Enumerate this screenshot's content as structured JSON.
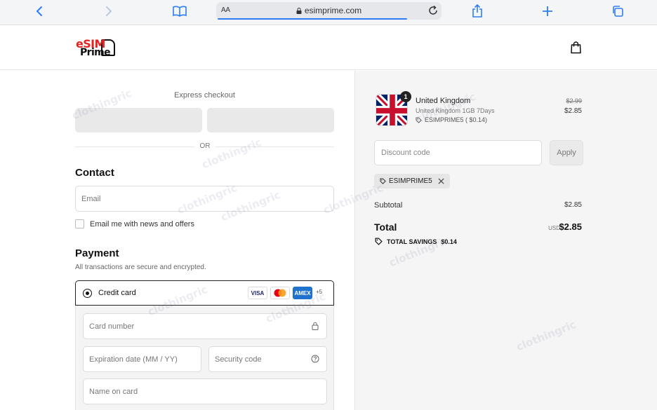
{
  "browser": {
    "aa": "AA",
    "url": "esimprime.com"
  },
  "header": {
    "logo_line1": "eSIM",
    "logo_line2": "Prime"
  },
  "express": {
    "label": "Express checkout",
    "or": "OR"
  },
  "contact": {
    "title": "Contact",
    "email_placeholder": "Email",
    "newsletter_label": "Email me with news and offers"
  },
  "payment": {
    "title": "Payment",
    "subtitle": "All transactions are secure and encrypted.",
    "method_label": "Credit card",
    "card_logos": [
      "VISA",
      "",
      "AMEX"
    ],
    "more_cards": "+5",
    "card_number_placeholder": "Card number",
    "expiration_placeholder": "Expiration date (MM / YY)",
    "security_placeholder": "Security code",
    "name_placeholder": "Name on card"
  },
  "order": {
    "product_name": "United Kingdom",
    "product_variant": "United Kingdom 1GB 7Days",
    "product_discount": "ESIMPRIME5 ( $0.14)",
    "quantity": "1",
    "price_old": "$2.99",
    "price_new": "$2.85",
    "discount_placeholder": "Discount code",
    "apply_label": "Apply",
    "applied_code": "ESIMPRIME5",
    "subtotal_label": "Subtotal",
    "subtotal_value": "$2.85",
    "total_label": "Total",
    "total_currency": "USD",
    "total_value": "$2.85",
    "savings_label": "TOTAL SAVINGS",
    "savings_value": "$0.14"
  },
  "watermark": "clothingric",
  "colors": {
    "accent": "#2f7df6",
    "brand_red": "#e42323"
  }
}
